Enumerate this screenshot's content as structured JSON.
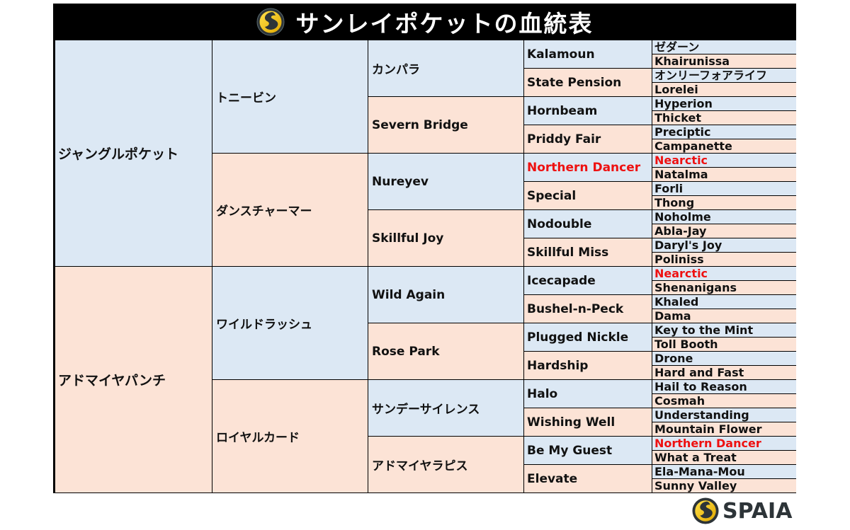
{
  "title": "サンレイポケットの血統表",
  "brand": {
    "name": "SPAIA",
    "logo_icon": "spaia-swirl-icon",
    "colors": {
      "logo_yellow": "#f5c400",
      "logo_dark": "#2d3438",
      "title_bg": "#000000"
    }
  },
  "colors": {
    "sire_cell": "#dce8f4",
    "dam_cell": "#fce3d6",
    "highlight_text": "#ee1111"
  },
  "pedigree": {
    "gen1": [
      {
        "name": "ジャングルポケット",
        "side": "sire"
      },
      {
        "name": "アドマイヤパンチ",
        "side": "dam"
      }
    ],
    "gen2": [
      {
        "name": "トニービン",
        "side": "sire"
      },
      {
        "name": "ダンスチャーマー",
        "side": "dam"
      },
      {
        "name": "ワイルドラッシュ",
        "side": "sire"
      },
      {
        "name": "ロイヤルカード",
        "side": "dam"
      }
    ],
    "gen3": [
      {
        "name": "カンパラ",
        "side": "sire"
      },
      {
        "name": "Severn Bridge",
        "side": "dam"
      },
      {
        "name": "Nureyev",
        "side": "sire"
      },
      {
        "name": "Skillful Joy",
        "side": "dam"
      },
      {
        "name": "Wild Again",
        "side": "sire"
      },
      {
        "name": "Rose Park",
        "side": "dam"
      },
      {
        "name": "サンデーサイレンス",
        "side": "sire"
      },
      {
        "name": "アドマイヤラピス",
        "side": "dam"
      }
    ],
    "gen4": [
      {
        "name": "Kalamoun",
        "side": "sire"
      },
      {
        "name": "State Pension",
        "side": "dam"
      },
      {
        "name": "Hornbeam",
        "side": "sire"
      },
      {
        "name": "Priddy Fair",
        "side": "dam"
      },
      {
        "name": "Northern Dancer",
        "side": "sire",
        "highlight": true
      },
      {
        "name": "Special",
        "side": "dam"
      },
      {
        "name": "Nodouble",
        "side": "sire"
      },
      {
        "name": "Skillful Miss",
        "side": "dam"
      },
      {
        "name": "Icecapade",
        "side": "sire"
      },
      {
        "name": "Bushel-n-Peck",
        "side": "dam"
      },
      {
        "name": "Plugged Nickle",
        "side": "sire"
      },
      {
        "name": "Hardship",
        "side": "dam"
      },
      {
        "name": "Halo",
        "side": "sire"
      },
      {
        "name": "Wishing Well",
        "side": "dam"
      },
      {
        "name": "Be My Guest",
        "side": "sire"
      },
      {
        "name": "Elevate",
        "side": "dam"
      }
    ],
    "gen5": [
      {
        "name": "ゼダーン",
        "side": "sire"
      },
      {
        "name": "Khairunissa",
        "side": "dam"
      },
      {
        "name": "オンリーフォアライフ",
        "side": "sire"
      },
      {
        "name": "Lorelei",
        "side": "dam"
      },
      {
        "name": "Hyperion",
        "side": "sire"
      },
      {
        "name": "Thicket",
        "side": "dam"
      },
      {
        "name": "Preciptic",
        "side": "sire"
      },
      {
        "name": "Campanette",
        "side": "dam"
      },
      {
        "name": "Nearctic",
        "side": "sire",
        "highlight": true
      },
      {
        "name": "Natalma",
        "side": "dam"
      },
      {
        "name": "Forli",
        "side": "sire"
      },
      {
        "name": "Thong",
        "side": "dam"
      },
      {
        "name": "Noholme",
        "side": "sire"
      },
      {
        "name": "Abla-Jay",
        "side": "dam"
      },
      {
        "name": "Daryl's Joy",
        "side": "sire"
      },
      {
        "name": "Poliniss",
        "side": "dam"
      },
      {
        "name": "Nearctic",
        "side": "sire",
        "highlight": true
      },
      {
        "name": "Shenanigans",
        "side": "dam"
      },
      {
        "name": "Khaled",
        "side": "sire"
      },
      {
        "name": "Dama",
        "side": "dam"
      },
      {
        "name": "Key to the Mint",
        "side": "sire"
      },
      {
        "name": "Toll Booth",
        "side": "dam"
      },
      {
        "name": "Drone",
        "side": "sire"
      },
      {
        "name": "Hard and Fast",
        "side": "dam"
      },
      {
        "name": "Hail to Reason",
        "side": "sire"
      },
      {
        "name": "Cosmah",
        "side": "dam"
      },
      {
        "name": "Understanding",
        "side": "sire"
      },
      {
        "name": "Mountain Flower",
        "side": "dam"
      },
      {
        "name": "Northern Dancer",
        "side": "sire",
        "highlight": true
      },
      {
        "name": "What a Treat",
        "side": "dam"
      },
      {
        "name": "Ela-Mana-Mou",
        "side": "sire"
      },
      {
        "name": "Sunny Valley",
        "side": "dam"
      }
    ]
  }
}
